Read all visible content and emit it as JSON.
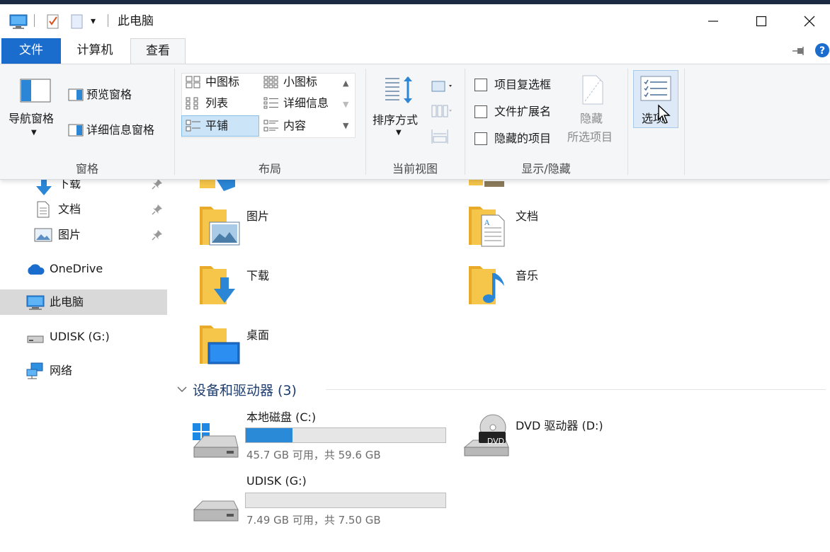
{
  "window": {
    "title": "此电脑"
  },
  "tabs": {
    "file": "文件",
    "computer": "计算机",
    "view": "查看"
  },
  "ribbon": {
    "panes": {
      "label": "窗格",
      "nav_pane": "导航窗格",
      "preview_pane": "预览窗格",
      "details_pane": "详细信息窗格"
    },
    "layout": {
      "label": "布局",
      "items": [
        "中图标",
        "小图标",
        "列表",
        "详细信息",
        "平铺",
        "内容"
      ],
      "selected": "平铺"
    },
    "current_view": {
      "label": "当前视图",
      "sort": "排序方式"
    },
    "show_hide": {
      "label": "显示/隐藏",
      "item_checkboxes": "项目复选框",
      "file_extensions": "文件扩展名",
      "hidden_items": "隐藏的项目",
      "hide_selected_line1": "隐藏",
      "hide_selected_line2": "所选项目"
    },
    "options": {
      "label": "选项"
    }
  },
  "nav": {
    "downloads": "下载",
    "documents": "文档",
    "pictures": "图片",
    "onedrive": "OneDrive",
    "this_pc": "此电脑",
    "udisk": "UDISK (G:)",
    "network": "网络"
  },
  "folders": {
    "pictures": "图片",
    "documents": "文档",
    "downloads": "下载",
    "music": "音乐",
    "desktop": "桌面"
  },
  "devices": {
    "header": "设备和驱动器 (3)",
    "local_c": {
      "name": "本地磁盘 (C:)",
      "space": "45.7 GB 可用，共 59.6 GB",
      "used_fraction": 0.233
    },
    "dvd": {
      "name": "DVD 驱动器 (D:)",
      "badge": "DVD"
    },
    "udisk": {
      "name": "UDISK (G:)",
      "space": "7.49 GB 可用，共 7.50 GB",
      "used_fraction": 0.0013
    }
  },
  "colors": {
    "accent": "#1a6ccd",
    "bar_fill": "#2a8ad8",
    "folder": "#f5c64a",
    "selected_nav": "#d9d9d9"
  }
}
